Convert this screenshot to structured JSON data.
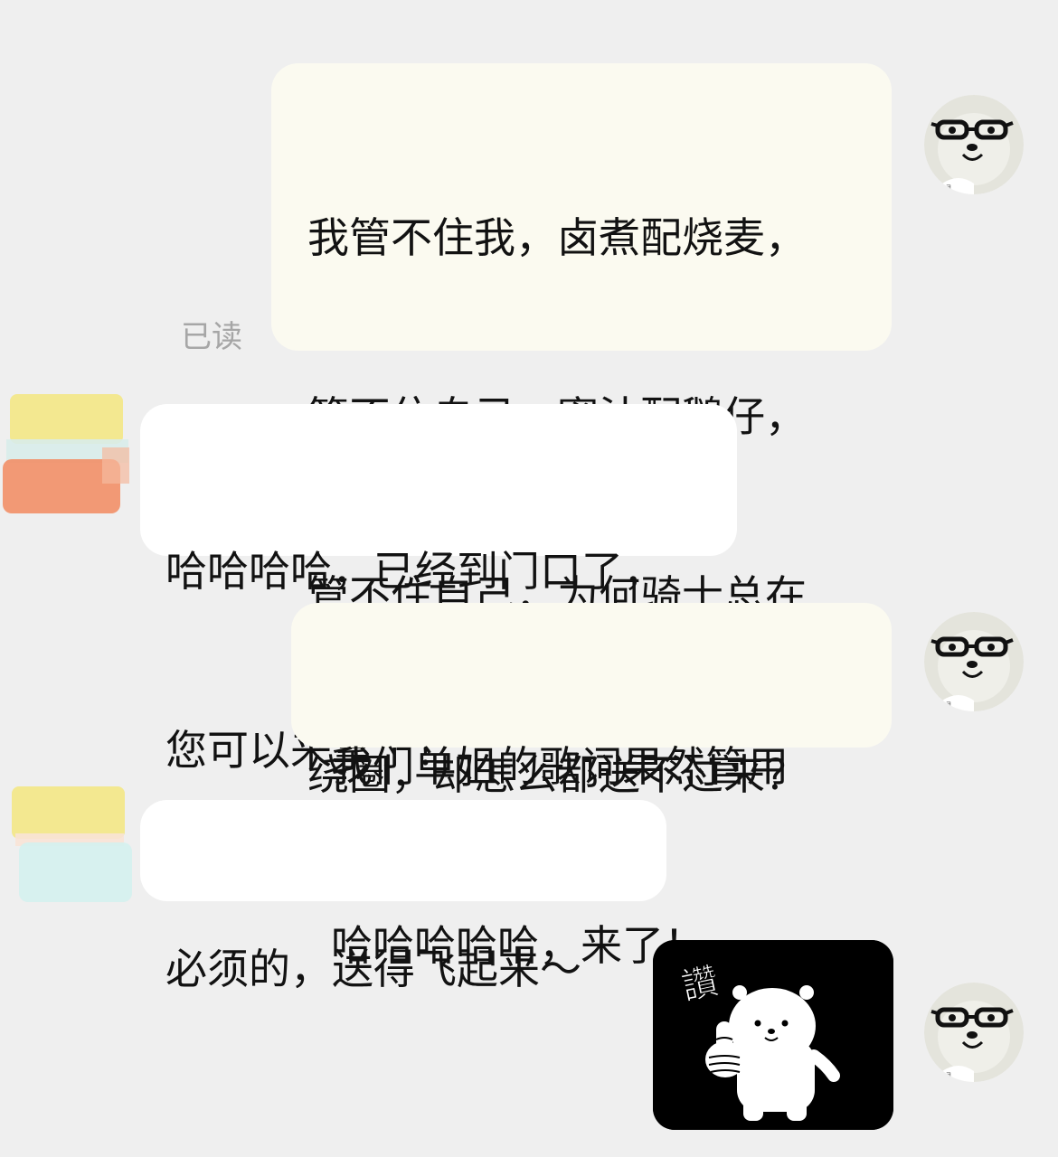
{
  "messages": [
    {
      "direction": "outgoing",
      "lines": [
        "我管不住我，卤煮配烧麦，",
        "管不住自己，蜜汁配鹅仔，",
        "管不住自己，为何骑士总在",
        "绕圈，却怎么都送不过来？"
      ],
      "read_status": "已读"
    },
    {
      "direction": "incoming",
      "lines": [
        "哈哈哈哈，已经到门口了，",
        "您可以来拿了！"
      ]
    },
    {
      "direction": "outgoing",
      "lines": [
        "我们单姐的歌词果然管用",
        "哈哈哈哈哈，来了！"
      ]
    },
    {
      "direction": "incoming",
      "lines": [
        "必须的，送得飞起来～"
      ]
    },
    {
      "direction": "outgoing",
      "type": "sticker",
      "sticker": {
        "icon": "thumbs-up-bear-sticker",
        "text": "讚"
      }
    }
  ],
  "icons": {
    "self_avatar": "bear-with-glasses-avatar",
    "contact_avatar": "pastel-blur-avatar"
  },
  "colors": {
    "background": "#efefef",
    "outgoing_bubble": "#fbfaf0",
    "incoming_bubble": "#ffffff",
    "read_status": "#a6a6a6"
  }
}
